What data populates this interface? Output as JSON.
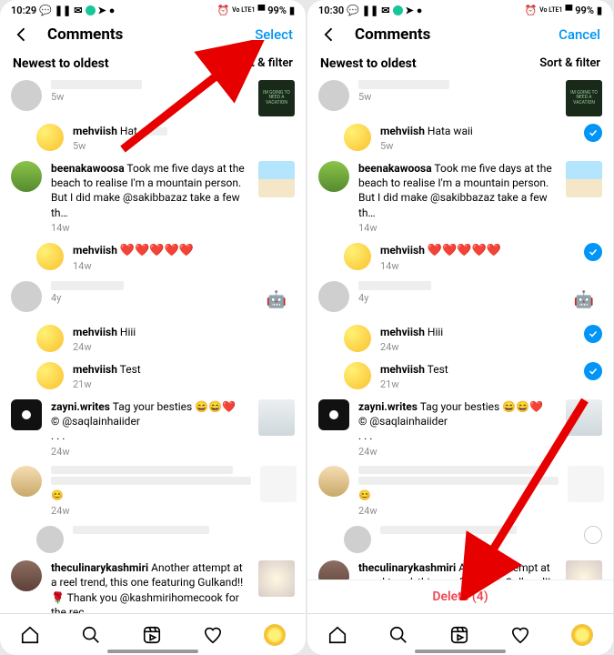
{
  "left": {
    "status": {
      "time": "10:29",
      "battery": "99%",
      "net": "Vo LTE1"
    },
    "header": {
      "title": "Comments",
      "action": "Select"
    },
    "sort": {
      "label": "Newest to oldest",
      "filter": "Sort & filter"
    }
  },
  "right": {
    "status": {
      "time": "10:30",
      "battery": "99%",
      "net": "Vo LTE1"
    },
    "header": {
      "title": "Comments",
      "action": "Cancel"
    },
    "sort": {
      "label": "Newest to oldest",
      "filter": "Sort & filter"
    },
    "delete": "Delete (4)"
  },
  "comments": {
    "c1_time": "5w",
    "c2_user": "mehviish",
    "c2_text": "Hata waii",
    "c2_text_blur": "Hat",
    "c2_time": "5w",
    "c3_user": "beenakawoosa",
    "c3_text": "Took me five days at the beach to realise I'm a mountain person. But I did make @sakibbazaz take a few th…",
    "c3_time": "14w",
    "c4_user": "mehviish",
    "c4_hearts": "❤️❤️❤️❤️❤️",
    "c4_time": "14w",
    "c5_time": "4y",
    "c6_user": "mehviish",
    "c6_text": "Hiii",
    "c6_time": "24w",
    "c7_user": "mehviish",
    "c7_text": "Test",
    "c7_time": "21w",
    "c8_user": "zayni.writes",
    "c8_text": "Tag your besties 😄😄❤️",
    "c8_credit": "© @saqlainhaiider",
    "c8_time": "24w",
    "c8_dots": ". . .",
    "c9_time": "24w",
    "c10_user": "theculinarykashmiri",
    "c10_text": "Another attempt at a reel trend, this one featuring Gulkand!! 🌹 Thank you @kashmirihomecook for the rec…",
    "c10_text_r": "Another attempt at a reel trend, this one featuring Gulkand!! 🌹"
  }
}
